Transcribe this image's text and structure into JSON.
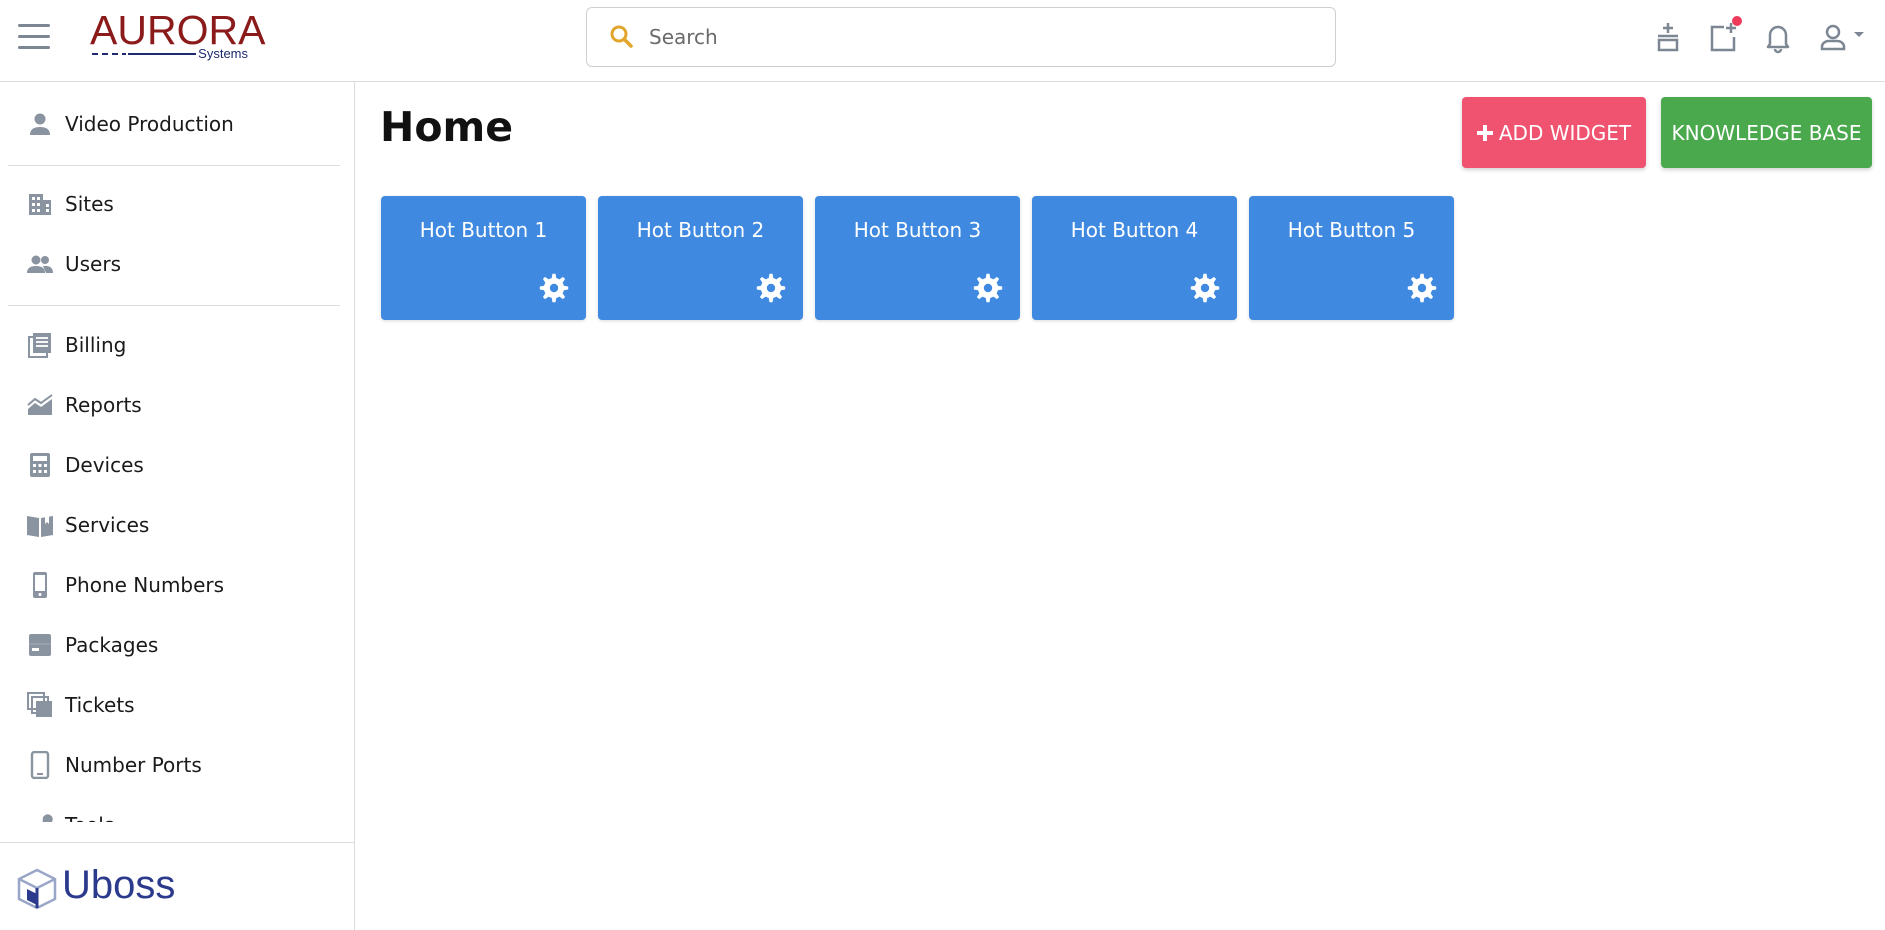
{
  "header": {
    "logo_main": "AURORA",
    "logo_sub": "Systems",
    "search_placeholder": "Search"
  },
  "sidebar": {
    "items": [
      {
        "label": "Video Production",
        "icon": "person-icon"
      },
      {
        "label": "Sites",
        "icon": "building-icon"
      },
      {
        "label": "Users",
        "icon": "people-icon"
      },
      {
        "label": "Billing",
        "icon": "billing-icon"
      },
      {
        "label": "Reports",
        "icon": "chart-area-icon"
      },
      {
        "label": "Devices",
        "icon": "calculator-icon"
      },
      {
        "label": "Services",
        "icon": "book-open-icon"
      },
      {
        "label": "Phone Numbers",
        "icon": "phone-icon"
      },
      {
        "label": "Packages",
        "icon": "package-icon"
      },
      {
        "label": "Tickets",
        "icon": "tickets-icon"
      },
      {
        "label": "Number Ports",
        "icon": "mobile-icon"
      },
      {
        "label": "Tools",
        "icon": "tools-icon"
      }
    ],
    "footer_brand": "Uboss"
  },
  "main": {
    "title": "Home",
    "add_widget_label": "ADD WIDGET",
    "knowledge_base_label": "KNOWLEDGE BASE",
    "hot_buttons": [
      {
        "label": "Hot Button 1"
      },
      {
        "label": "Hot Button 2"
      },
      {
        "label": "Hot Button 3"
      },
      {
        "label": "Hot Button 4"
      },
      {
        "label": "Hot Button 5"
      }
    ]
  },
  "colors": {
    "accent_blue": "#3f8ae0",
    "add_widget": "#ef5370",
    "knowledge_base": "#4aa84d",
    "logo_red": "#8b1a1a",
    "logo_navy": "#1e2a6e",
    "icon_gray": "#7d8794",
    "notification_dot": "#ee3b5b"
  }
}
